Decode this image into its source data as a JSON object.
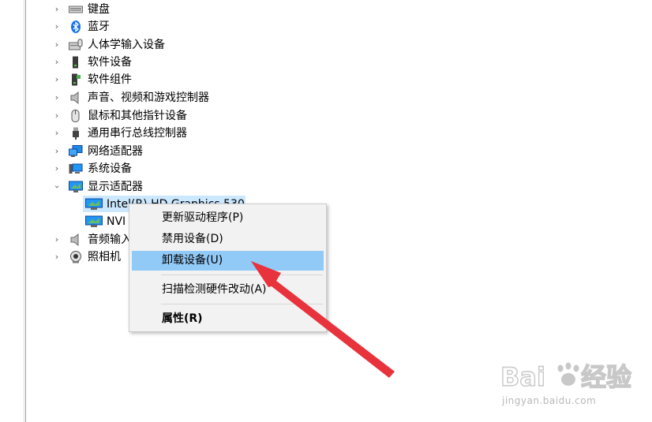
{
  "tree": {
    "categories": [
      {
        "label": "键盘",
        "icon": "keyboard-icon",
        "expanded": false
      },
      {
        "label": "蓝牙",
        "icon": "bluetooth-icon",
        "expanded": false
      },
      {
        "label": "人体学输入设备",
        "icon": "hid-icon",
        "expanded": false
      },
      {
        "label": "软件设备",
        "icon": "software-device-icon",
        "expanded": false
      },
      {
        "label": "软件组件",
        "icon": "software-component-icon",
        "expanded": false
      },
      {
        "label": "声音、视频和游戏控制器",
        "icon": "speaker-icon",
        "expanded": false
      },
      {
        "label": "鼠标和其他指针设备",
        "icon": "mouse-icon",
        "expanded": false
      },
      {
        "label": "通用串行总线控制器",
        "icon": "usb-icon",
        "expanded": false
      },
      {
        "label": "网络适配器",
        "icon": "network-adapter-icon",
        "expanded": false
      },
      {
        "label": "系统设备",
        "icon": "system-device-icon",
        "expanded": false
      },
      {
        "label": "显示适配器",
        "icon": "display-adapter-icon",
        "expanded": true
      }
    ],
    "display_children": [
      {
        "label": "Intel(R) HD Graphics 530",
        "selected": true
      },
      {
        "label": "NVI",
        "selected": false
      }
    ],
    "after_categories": [
      {
        "label": "音频输入",
        "icon": "audio-input-icon"
      },
      {
        "label": "照相机",
        "icon": "camera-icon"
      }
    ]
  },
  "context_menu": {
    "items": [
      {
        "label": "更新驱动程序(P)",
        "highlighted": false,
        "bold": false
      },
      {
        "label": "禁用设备(D)",
        "highlighted": false,
        "bold": false
      },
      {
        "label": "卸载设备(U)",
        "highlighted": true,
        "bold": false
      },
      {
        "label": "扫描检测硬件改动(A)",
        "highlighted": false,
        "bold": false
      },
      {
        "label": "属性(R)",
        "highlighted": false,
        "bold": true
      }
    ]
  },
  "annotation": {
    "color": "#e8323c"
  },
  "watermark": {
    "brand": "Baidu经验",
    "url": "jingyan.baidu.com"
  },
  "colors": {
    "selection": "#cce8ff",
    "menu_highlight": "#91c9f7",
    "menu_bg": "#f2f2f2"
  }
}
